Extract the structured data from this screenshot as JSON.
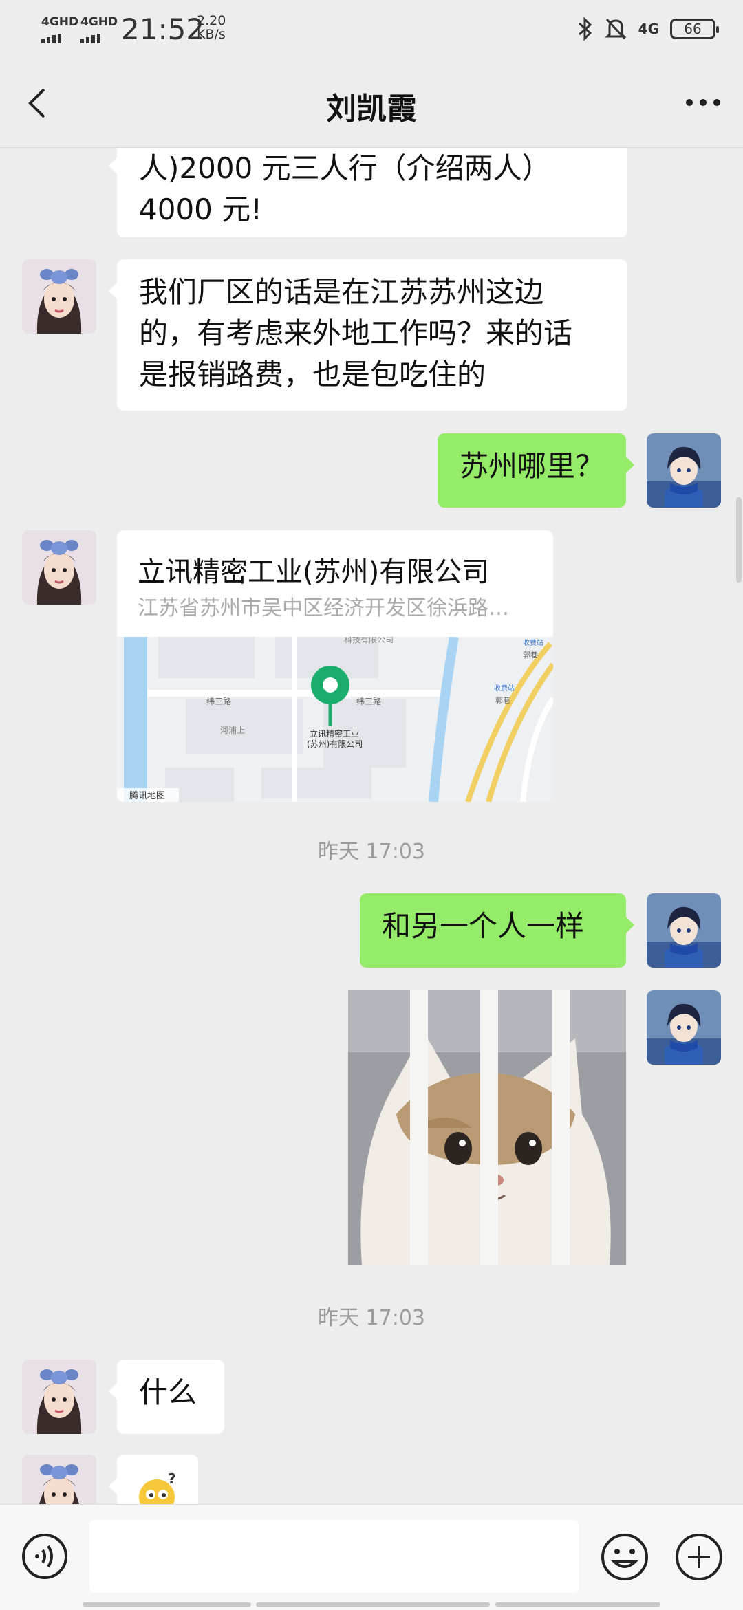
{
  "status_bar": {
    "network_1": "4GHD",
    "network_2": "4GHD",
    "time": "21:52",
    "speed_value": "2.20",
    "speed_unit": "KB/s",
    "right_network": "4G",
    "battery": "66",
    "icons": [
      "bluetooth-icon",
      "mute-bell-icon",
      "signal-4g-icon",
      "battery-icon"
    ]
  },
  "nav": {
    "title": "刘凯霞",
    "back_icon": "chevron-left-icon",
    "more_icon": "more-dots-icon"
  },
  "messages": [
    {
      "side": "left",
      "type": "text",
      "text": "人)2000 元三人行（介绍两人）\n4000 元!"
    },
    {
      "side": "left",
      "type": "text",
      "text": "我们厂区的话是在江苏苏州这边\n的，有考虑来外地工作吗？来的话\n是报销路费，也是包吃住的"
    },
    {
      "side": "right",
      "type": "text",
      "text": "苏州哪里？"
    },
    {
      "side": "left",
      "type": "location",
      "name": "立讯精密工业(苏州)有限公司",
      "address": "江苏省苏州市吴中区经济开发区徐浜路…",
      "map_provider": "腾讯地图",
      "map_labels": [
        "科技有限公司",
        "纬三路",
        "纬三路",
        "河浦上",
        "立讯精密工业",
        "(苏州)有限公司",
        "收费站",
        "郭巷",
        "收费站",
        "郭巷"
      ]
    },
    {
      "type": "timestamp",
      "text": "昨天 17:03"
    },
    {
      "side": "right",
      "type": "text",
      "text": "和另一个人一样"
    },
    {
      "side": "right",
      "type": "image",
      "content": "cat-behind-bars-image"
    },
    {
      "type": "timestamp",
      "text": "昨天 17:03"
    },
    {
      "side": "left",
      "type": "text",
      "text": "什么"
    },
    {
      "side": "left",
      "type": "emoji",
      "content": "confused-face-emoji"
    }
  ],
  "input_bar": {
    "voice_icon": "voice-icon",
    "input_value": "",
    "emoji_icon": "smiley-icon",
    "plus_icon": "plus-icon"
  },
  "colors": {
    "background": "#ededed",
    "bubble_self": "#95ec69",
    "bubble_other": "#ffffff",
    "map_pin": "#1aad6b"
  }
}
